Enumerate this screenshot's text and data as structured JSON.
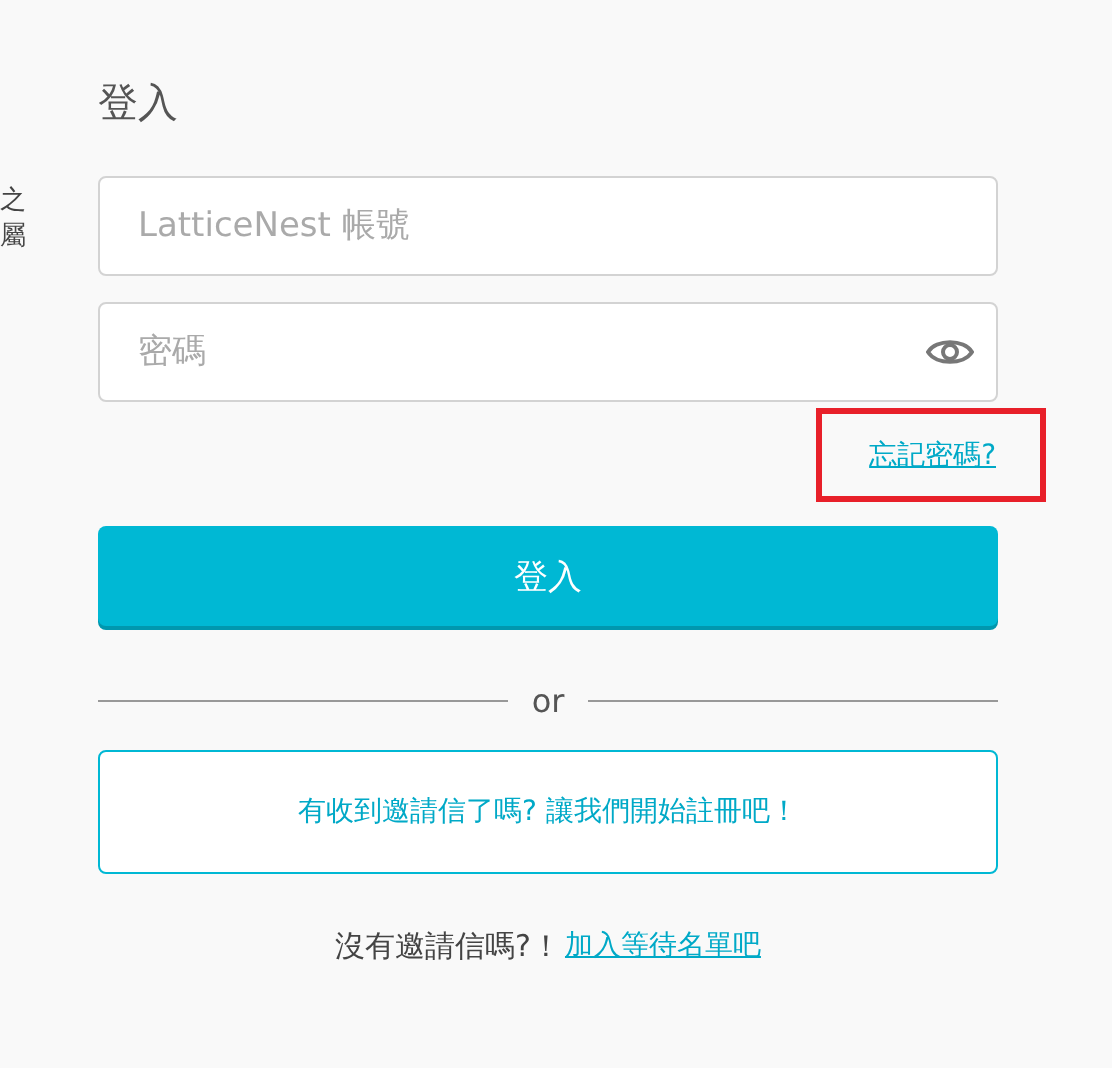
{
  "side_text": [
    "之",
    "屬"
  ],
  "title": "登入",
  "fields": [
    {
      "placeholder": "LatticeNest 帳號",
      "kind": "text"
    },
    {
      "placeholder": "密碼",
      "kind": "password"
    }
  ],
  "forgot_link": {
    "label": "忘記密碼?",
    "highlighted": true
  },
  "submit": "登入",
  "divider": "or",
  "invite_button": "有收到邀請信了嗎? 讓我們開始註冊吧！",
  "footer": {
    "text": "沒有邀請信嗎?！",
    "link": "加入等待名單吧"
  }
}
